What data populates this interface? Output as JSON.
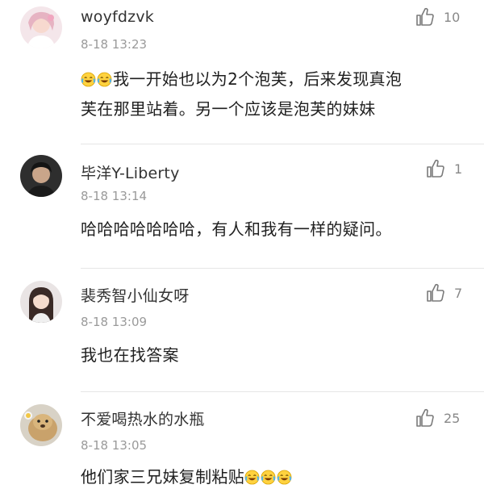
{
  "comments": [
    {
      "username": "woyfdzvk",
      "timestamp": "8-18 13:23",
      "text_line1": "我一开始也以为2个泡芙，后来发现真泡",
      "text_line2": "芙在那里站着。另一个应该是泡芙的妹妹",
      "leading_emoji": [
        "laughing-crying-emoji",
        "laughing-crying-emoji"
      ],
      "likes": "10",
      "like_icon": "thumbs-up-icon"
    },
    {
      "username": "毕洋Y-Liberty",
      "timestamp": "8-18 13:14",
      "text_line1": "哈哈哈哈哈哈哈，有人和我有一样的疑问。",
      "likes": "1",
      "like_icon": "thumbs-up-icon"
    },
    {
      "username": "裴秀智小仙女呀",
      "timestamp": "8-18 13:09",
      "text_line1": "我也在找答案",
      "likes": "7",
      "like_icon": "thumbs-up-icon"
    },
    {
      "username": "不爱喝热水的水瓶",
      "timestamp": "8-18 13:05",
      "text_line1": "他们家三兄妹复制粘贴",
      "trailing_emoji": [
        "laughing-crying-emoji",
        "laughing-crying-emoji",
        "laughing-crying-emoji"
      ],
      "likes": "25",
      "like_icon": "thumbs-up-icon"
    }
  ]
}
